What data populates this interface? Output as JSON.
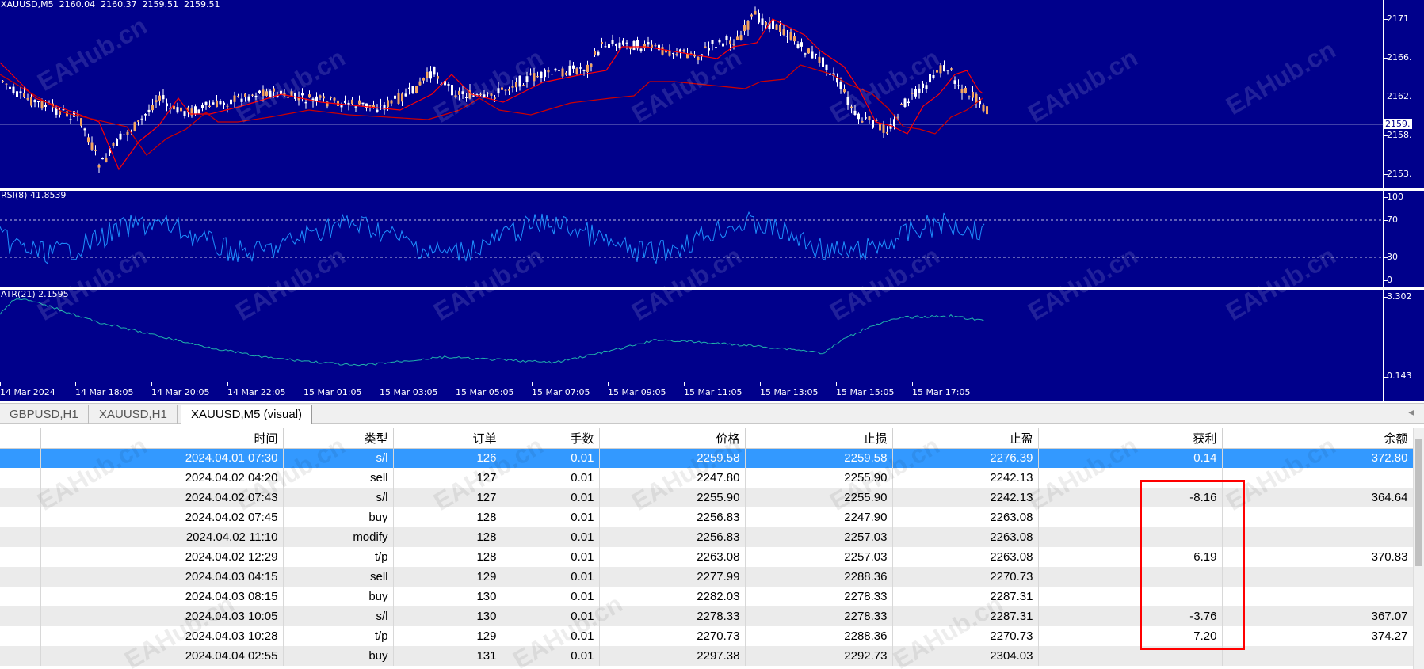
{
  "chart": {
    "main_label": "XAUUSD,M5  2160.04  2160.37  2159.51  2159.51",
    "rsi_label": "RSI(8) 41.8539",
    "atr_label": "ATR(21) 2.1595",
    "main_scale": [
      "2171",
      "2166.",
      "2162.",
      "2158.",
      "2153."
    ],
    "main_current": "2159.",
    "rsi_scale": [
      "100",
      "70",
      "30",
      "0"
    ],
    "atr_scale": [
      "3.302",
      "0.143"
    ],
    "time_labels": [
      "14 Mar 2024",
      "14 Mar 18:05",
      "14 Mar 20:05",
      "14 Mar 22:05",
      "15 Mar 01:05",
      "15 Mar 03:05",
      "15 Mar 05:05",
      "15 Mar 07:05",
      "15 Mar 09:05",
      "15 Mar 11:05",
      "15 Mar 13:05",
      "15 Mar 15:05",
      "15 Mar 17:05"
    ],
    "colors": {
      "background": "#00008b",
      "candle": "#ffffff",
      "ma": "#ff0000",
      "rsi": "#1e90ff",
      "atr": "#20b2aa"
    }
  },
  "tabs": [
    {
      "label": "GBPUSD,H1"
    },
    {
      "label": "XAUUSD,H1"
    },
    {
      "label": "XAUUSD,M5 (visual)",
      "active": true
    }
  ],
  "table": {
    "headers": [
      "",
      "时间",
      "类型",
      "订单",
      "手数",
      "价格",
      "止损",
      "止盈",
      "获利",
      "余额"
    ],
    "rows": [
      [
        "2024.04.01 07:30",
        "s/l",
        "126",
        "0.01",
        "2259.58",
        "2259.58",
        "2276.39",
        "0.14",
        "372.80"
      ],
      [
        "2024.04.02 04:20",
        "sell",
        "127",
        "0.01",
        "2247.80",
        "2255.90",
        "2242.13",
        "",
        ""
      ],
      [
        "2024.04.02 07:43",
        "s/l",
        "127",
        "0.01",
        "2255.90",
        "2255.90",
        "2242.13",
        "-8.16",
        "364.64"
      ],
      [
        "2024.04.02 07:45",
        "buy",
        "128",
        "0.01",
        "2256.83",
        "2247.90",
        "2263.08",
        "",
        ""
      ],
      [
        "2024.04.02 11:10",
        "modify",
        "128",
        "0.01",
        "2256.83",
        "2257.03",
        "2263.08",
        "",
        ""
      ],
      [
        "2024.04.02 12:29",
        "t/p",
        "128",
        "0.01",
        "2263.08",
        "2257.03",
        "2263.08",
        "6.19",
        "370.83"
      ],
      [
        "2024.04.03 04:15",
        "sell",
        "129",
        "0.01",
        "2277.99",
        "2288.36",
        "2270.73",
        "",
        ""
      ],
      [
        "2024.04.03 08:15",
        "buy",
        "130",
        "0.01",
        "2282.03",
        "2278.33",
        "2287.31",
        "",
        ""
      ],
      [
        "2024.04.03 10:05",
        "s/l",
        "130",
        "0.01",
        "2278.33",
        "2278.33",
        "2287.31",
        "-3.76",
        "367.07"
      ],
      [
        "2024.04.03 10:28",
        "t/p",
        "129",
        "0.01",
        "2270.73",
        "2288.36",
        "2270.73",
        "7.20",
        "374.27"
      ],
      [
        "2024.04.04 02:55",
        "buy",
        "131",
        "0.01",
        "2297.38",
        "2292.73",
        "2304.03",
        "",
        ""
      ]
    ]
  },
  "watermark": "EAHub.cn",
  "icons": {
    "tab_scroll": "chevron-left-icon"
  }
}
